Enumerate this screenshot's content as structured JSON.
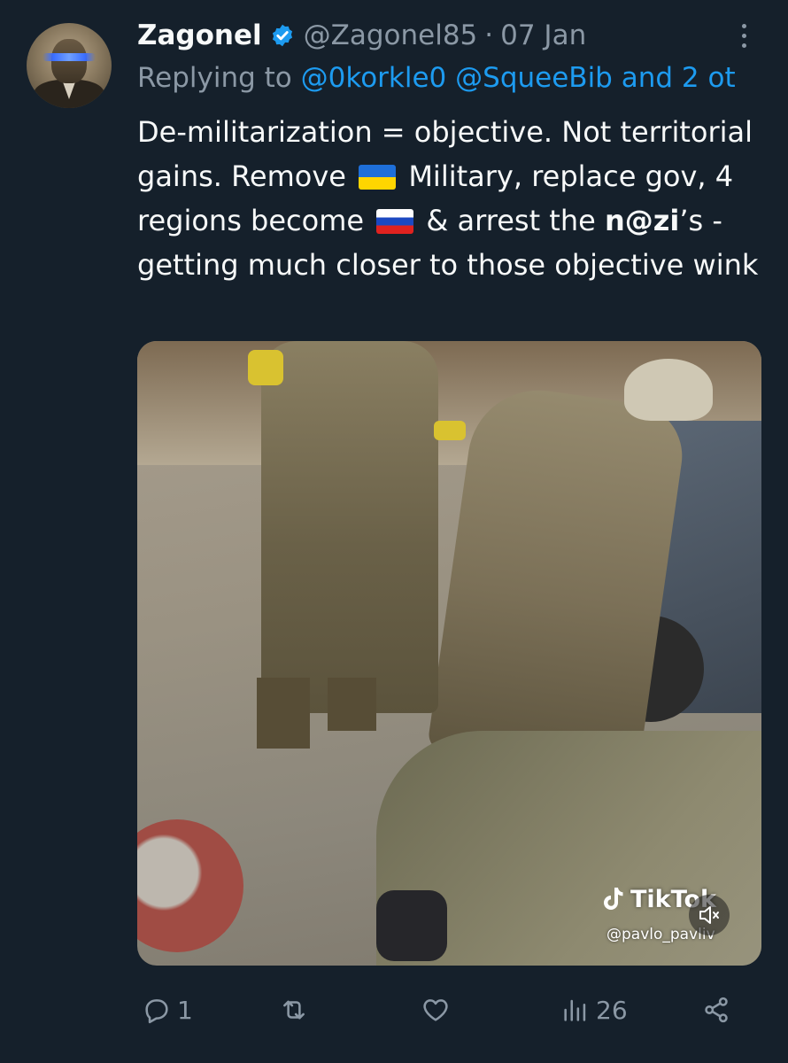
{
  "tweet": {
    "display_name": "Zagonel",
    "verified": true,
    "handle": "@Zagonel85",
    "separator": "·",
    "date": "07 Jan",
    "reply": {
      "prefix": "Replying to",
      "mentions": [
        "@0korkle0",
        "@SqueeBib"
      ],
      "suffix": "and 2 ot"
    },
    "text": {
      "part1": "De-militarization = objective. Not territorial gains. Remove",
      "part2": "Military, replace gov, 4 regions become",
      "part3": "& arrest the",
      "bold_word": "n@zi",
      "part4": "’s - getting much closer to those objective wink"
    }
  },
  "media": {
    "watermark_brand": "TikTok",
    "watermark_user": "@pavlo_pavliv"
  },
  "actions": {
    "replies": "1",
    "reposts": "",
    "likes": "",
    "views": "26"
  },
  "colors": {
    "background": "#15202b",
    "text_primary": "#f7f9f9",
    "text_secondary": "#8b98a5",
    "link": "#1d9bf0",
    "verified": "#1d9bf0"
  },
  "icons": [
    "verified-badge-icon",
    "more-icon",
    "mute-icon",
    "tiktok-icon",
    "reply-icon",
    "repost-icon",
    "like-icon",
    "views-icon",
    "share-icon"
  ]
}
